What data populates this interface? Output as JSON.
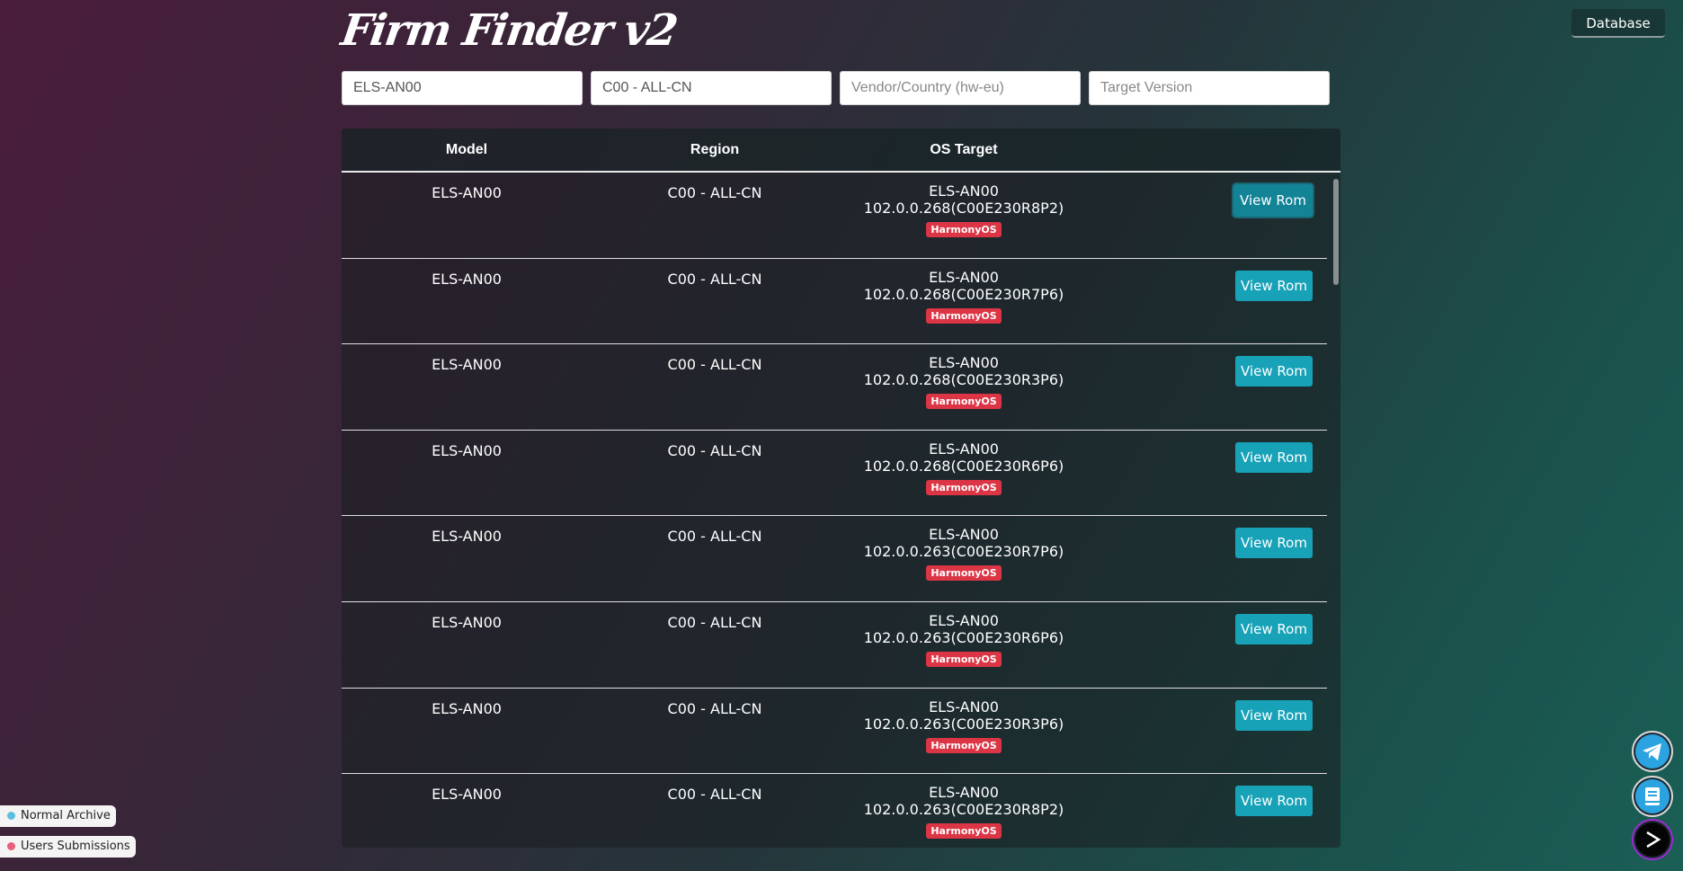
{
  "app": {
    "title": "Firm Finder v2",
    "database_label": "Database"
  },
  "filters": {
    "model_value": "ELS-AN00",
    "region_value": "C00 - ALL-CN",
    "vendor_placeholder": "Vendor/Country (hw-eu)",
    "version_placeholder": "Target Version"
  },
  "table": {
    "headers": {
      "model": "Model",
      "region": "Region",
      "os_target": "OS Target"
    },
    "view_label": "View Rom",
    "badge_color": "#dc3545",
    "rows": [
      {
        "model": "ELS-AN00",
        "region": "C00 - ALL-CN",
        "os_model": "ELS-AN00",
        "os_version": "102.0.0.268(C00E230R8P2)",
        "badge": "HarmonyOS"
      },
      {
        "model": "ELS-AN00",
        "region": "C00 - ALL-CN",
        "os_model": "ELS-AN00",
        "os_version": "102.0.0.268(C00E230R7P6)",
        "badge": "HarmonyOS"
      },
      {
        "model": "ELS-AN00",
        "region": "C00 - ALL-CN",
        "os_model": "ELS-AN00",
        "os_version": "102.0.0.268(C00E230R3P6)",
        "badge": "HarmonyOS"
      },
      {
        "model": "ELS-AN00",
        "region": "C00 - ALL-CN",
        "os_model": "ELS-AN00",
        "os_version": "102.0.0.268(C00E230R6P6)",
        "badge": "HarmonyOS"
      },
      {
        "model": "ELS-AN00",
        "region": "C00 - ALL-CN",
        "os_model": "ELS-AN00",
        "os_version": "102.0.0.263(C00E230R7P6)",
        "badge": "HarmonyOS"
      },
      {
        "model": "ELS-AN00",
        "region": "C00 - ALL-CN",
        "os_model": "ELS-AN00",
        "os_version": "102.0.0.263(C00E230R6P6)",
        "badge": "HarmonyOS"
      },
      {
        "model": "ELS-AN00",
        "region": "C00 - ALL-CN",
        "os_model": "ELS-AN00",
        "os_version": "102.0.0.263(C00E230R3P6)",
        "badge": "HarmonyOS"
      },
      {
        "model": "ELS-AN00",
        "region": "C00 - ALL-CN",
        "os_model": "ELS-AN00",
        "os_version": "102.0.0.263(C00E230R8P2)",
        "badge": "HarmonyOS"
      }
    ]
  },
  "legend": [
    {
      "label": "Normal Archive",
      "color": "#5bc0de"
    },
    {
      "label": "Users Submissions",
      "color": "#e8607a"
    }
  ],
  "fabs": [
    {
      "icon": "telegram-icon"
    },
    {
      "icon": "book-icon"
    },
    {
      "icon": "arrow-right-icon"
    }
  ]
}
